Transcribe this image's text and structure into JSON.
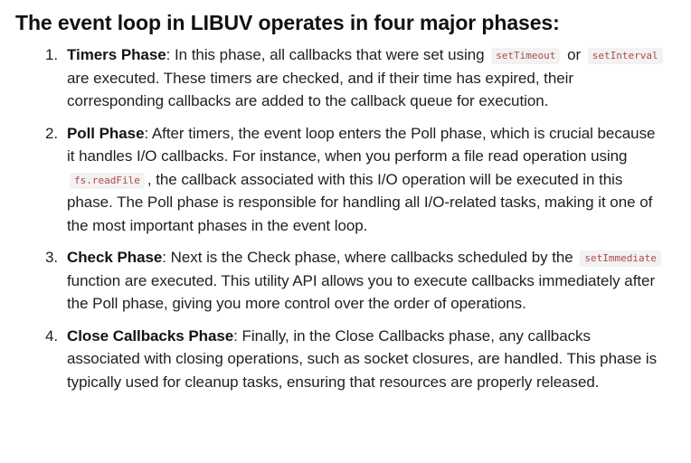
{
  "heading": "The event loop in LIBUV operates in four major phases:",
  "items": [
    {
      "number": "1.",
      "title": "Timers Phase",
      "segments": [
        ": In this phase, all callbacks that were set using ",
        "setTimeout",
        " or ",
        "setInterval",
        " are executed. These timers are checked, and if their time has expired, their corresponding callbacks are added to the callback queue for execution."
      ]
    },
    {
      "number": "2.",
      "title": "Poll Phase",
      "segments": [
        ": After timers, the event loop enters the Poll phase, which is crucial because it handles I/O callbacks. For instance, when you perform a file read operation using ",
        "fs.readFile",
        ", the callback associated with this I/O operation will be executed in this phase. The Poll phase is responsible for handling all I/O-related tasks, making it one of the most important phases in the event loop."
      ]
    },
    {
      "number": "3.",
      "title": "Check Phase",
      "segments": [
        ": Next is the Check phase, where callbacks scheduled by the ",
        "setImmediate",
        " function are executed. This utility API allows you to execute callbacks immediately after the Poll phase, giving you more control over the order of operations."
      ]
    },
    {
      "number": "4.",
      "title": "Close Callbacks Phase",
      "segments": [
        ": Finally, in the Close Callbacks phase, any callbacks associated with closing operations, such as socket closures, are handled. This phase is typically used for cleanup tasks, ensuring that resources are properly released."
      ]
    }
  ],
  "colors": {
    "text": "#1f1f1f",
    "code_text": "#b04a4a",
    "code_background": "#f2f2f2"
  }
}
